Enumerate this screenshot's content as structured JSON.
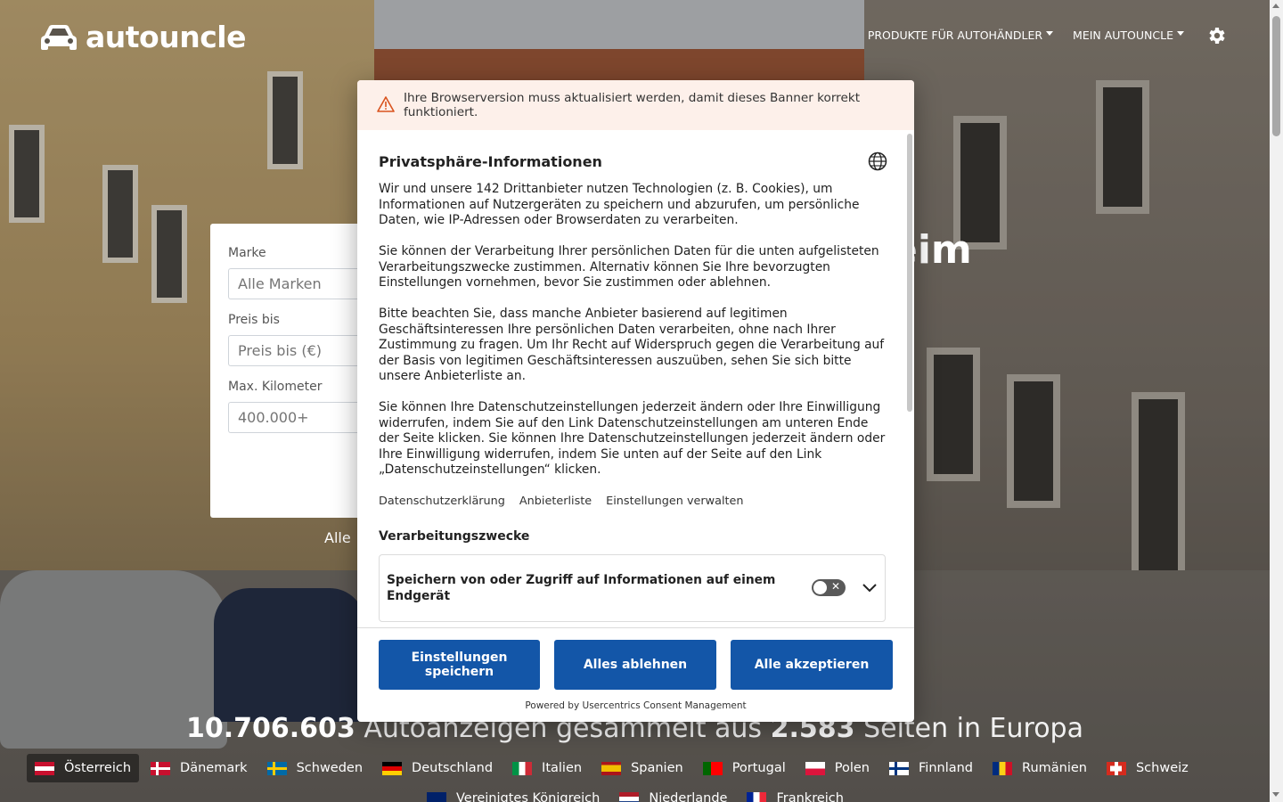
{
  "header": {
    "logo_text": "autouncle",
    "nav": [
      {
        "label": "PRODUKTE FÜR AUTOHÄNDLER"
      },
      {
        "label": "MEIN AUTOUNCLE"
      }
    ]
  },
  "hero": {
    "heading_fragment": "eim"
  },
  "search": {
    "brand_label": "Marke",
    "brand_placeholder": "Alle Marken",
    "price_label": "Preis bis",
    "price_placeholder": "Preis bis (€)",
    "km_label": "Max. Kilometer",
    "km_placeholder": "400.000+",
    "below_text": "Alle"
  },
  "stats": {
    "ads_count": "10.706.603",
    "ads_text": "Autoanzeigen gesammelt aus",
    "sites_count": "2.583",
    "sites_text": "Seiten in Europa"
  },
  "countries_row1": [
    {
      "label": "Österreich",
      "flag": "at",
      "active": true
    },
    {
      "label": "Dänemark",
      "flag": "dk"
    },
    {
      "label": "Schweden",
      "flag": "se"
    },
    {
      "label": "Deutschland",
      "flag": "de"
    },
    {
      "label": "Italien",
      "flag": "it"
    },
    {
      "label": "Spanien",
      "flag": "es"
    },
    {
      "label": "Portugal",
      "flag": "pt"
    },
    {
      "label": "Polen",
      "flag": "pl"
    },
    {
      "label": "Finnland",
      "flag": "fi"
    },
    {
      "label": "Rumänien",
      "flag": "ro"
    },
    {
      "label": "Schweiz",
      "flag": "ch"
    }
  ],
  "countries_row2": [
    {
      "label": "Vereinigtes Königreich",
      "flag": "gb"
    },
    {
      "label": "Niederlande",
      "flag": "nl"
    },
    {
      "label": "Frankreich",
      "flag": "fr"
    }
  ],
  "consent": {
    "warning": "Ihre Browserversion muss aktualisiert werden, damit dieses Banner korrekt funktioniert.",
    "title": "Privatsphäre-Informationen",
    "paragraphs": [
      "Wir und unsere 142 Drittanbieter nutzen Technologien (z. B. Cookies), um Informationen auf Nutzergeräten zu speichern und abzurufen, um persönliche Daten, wie IP-Adressen oder Browserdaten zu verarbeiten.",
      "Sie können der Verarbeitung Ihrer persönlichen Daten für die unten aufgelisteten Verarbeitungszwecke zustimmen. Alternativ können Sie Ihre bevorzugten Einstellungen vornehmen, bevor Sie zustimmen oder ablehnen.",
      "Bitte beachten Sie, dass manche Anbieter basierend auf legitimen Geschäftsinteressen Ihre persönlichen Daten verarbeiten, ohne nach Ihrer Zustimmung zu fragen. Um Ihr Recht auf Widerspruch gegen die Verarbeitung auf der Basis von legitimen Geschäftsinteressen auszuüben, sehen Sie sich bitte unsere Anbieterliste an.",
      "Sie können Ihre Datenschutzeinstellungen jederzeit ändern oder Ihre Einwilligung widerrufen, indem Sie auf den Link Datenschutzeinstellungen am unteren Ende der Seite klicken. Sie können Ihre Datenschutzeinstellungen jederzeit ändern oder Ihre Einwilligung widerrufen, indem Sie unten auf der Seite auf den Link „Datenschutzeinstellungen“ klicken."
    ],
    "links": [
      "Datenschutzerklärung",
      "Anbieterliste",
      "Einstellungen verwalten"
    ],
    "section_heading": "Verarbeitungszwecke",
    "purpose_label": "Speichern von oder Zugriff auf Informationen auf einem Endgerät",
    "purpose_enabled": false,
    "buttons": {
      "save": "Einstellungen speichern",
      "reject": "Alles ablehnen",
      "accept": "Alle akzeptieren"
    },
    "powered_by": "Powered by Usercentrics Consent Management",
    "button_color": "#1356a8"
  }
}
